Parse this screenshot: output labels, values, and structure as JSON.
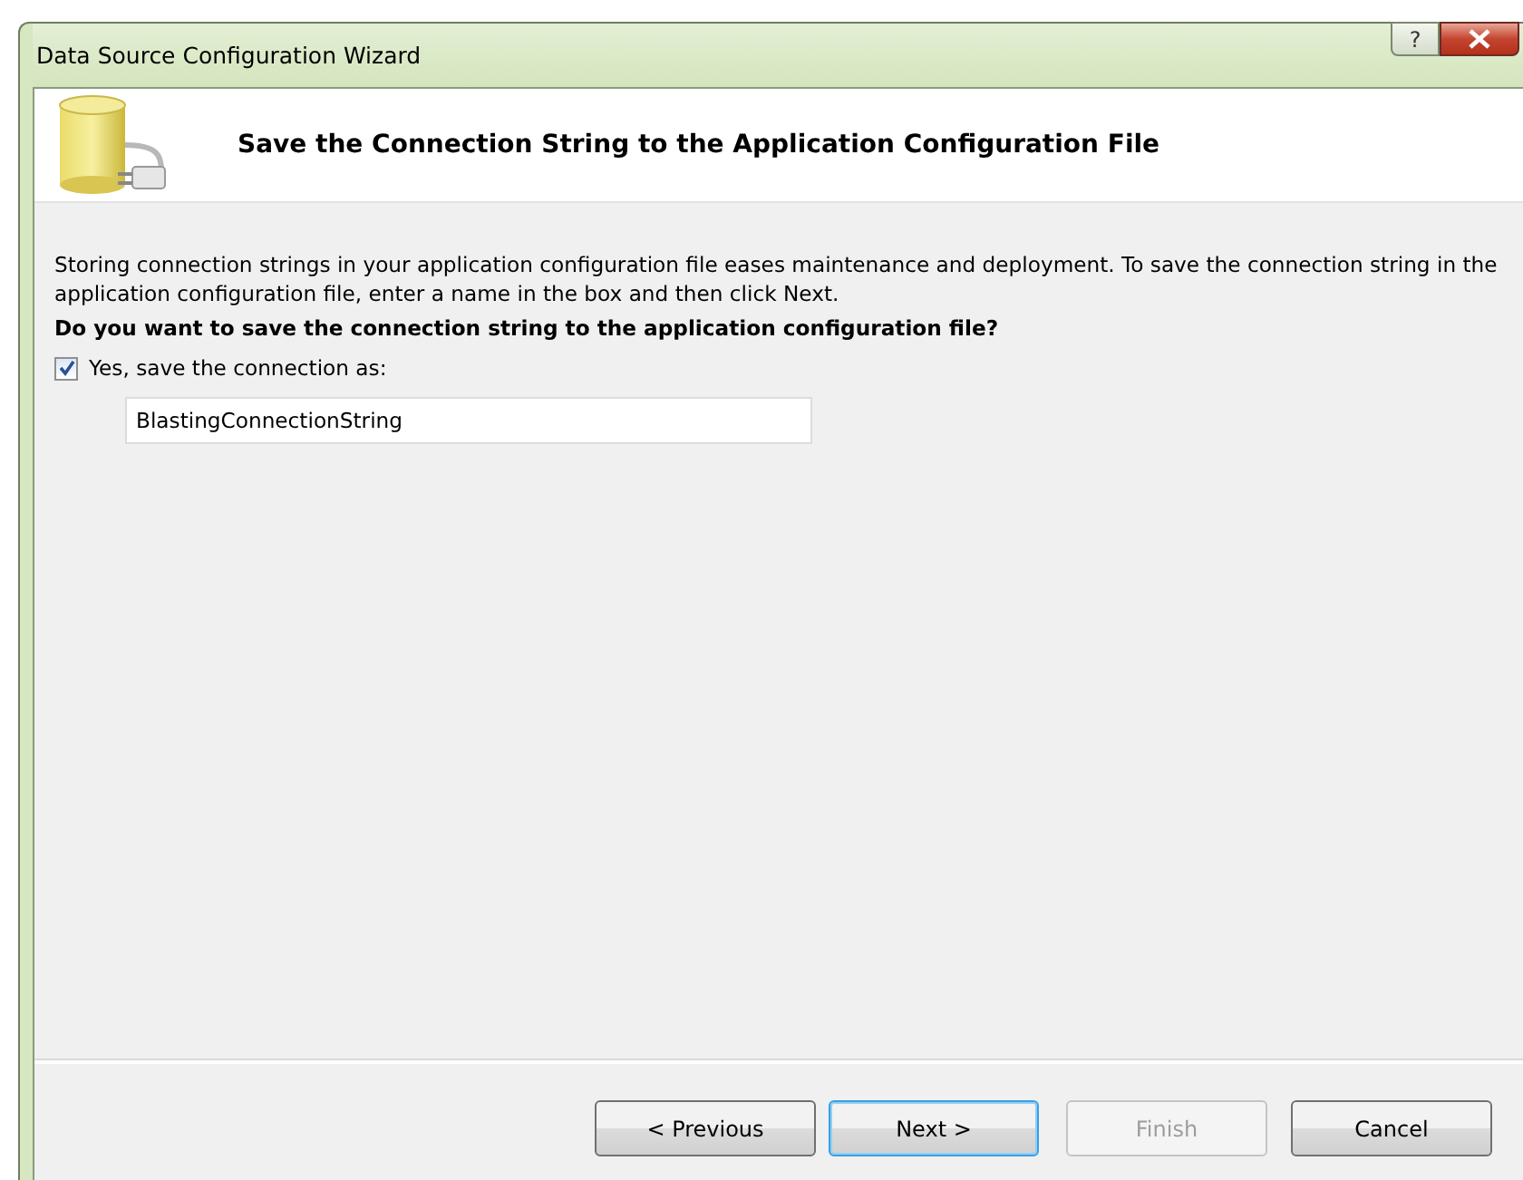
{
  "window": {
    "title": "Data Source Configuration Wizard",
    "help": "?"
  },
  "header": {
    "title": "Save the Connection String to the Application Configuration File"
  },
  "description": "Storing connection strings in your application configuration file eases maintenance and deployment. To save the connection string in the application configuration file, enter a name in the box and then click Next.",
  "question": "Do you want to save the connection string to the application configuration file?",
  "save_option": {
    "label": "Yes, save the connection as:",
    "checked": true
  },
  "connection_name": {
    "value": "BlastingConnectionString"
  },
  "buttons": [
    {
      "label": "< Previous",
      "default": false,
      "disabled": false
    },
    {
      "label": "Next >",
      "default": true,
      "disabled": false
    },
    {
      "label": "Finish",
      "default": false,
      "disabled": true
    },
    {
      "label": "Cancel",
      "default": false,
      "disabled": false
    }
  ]
}
